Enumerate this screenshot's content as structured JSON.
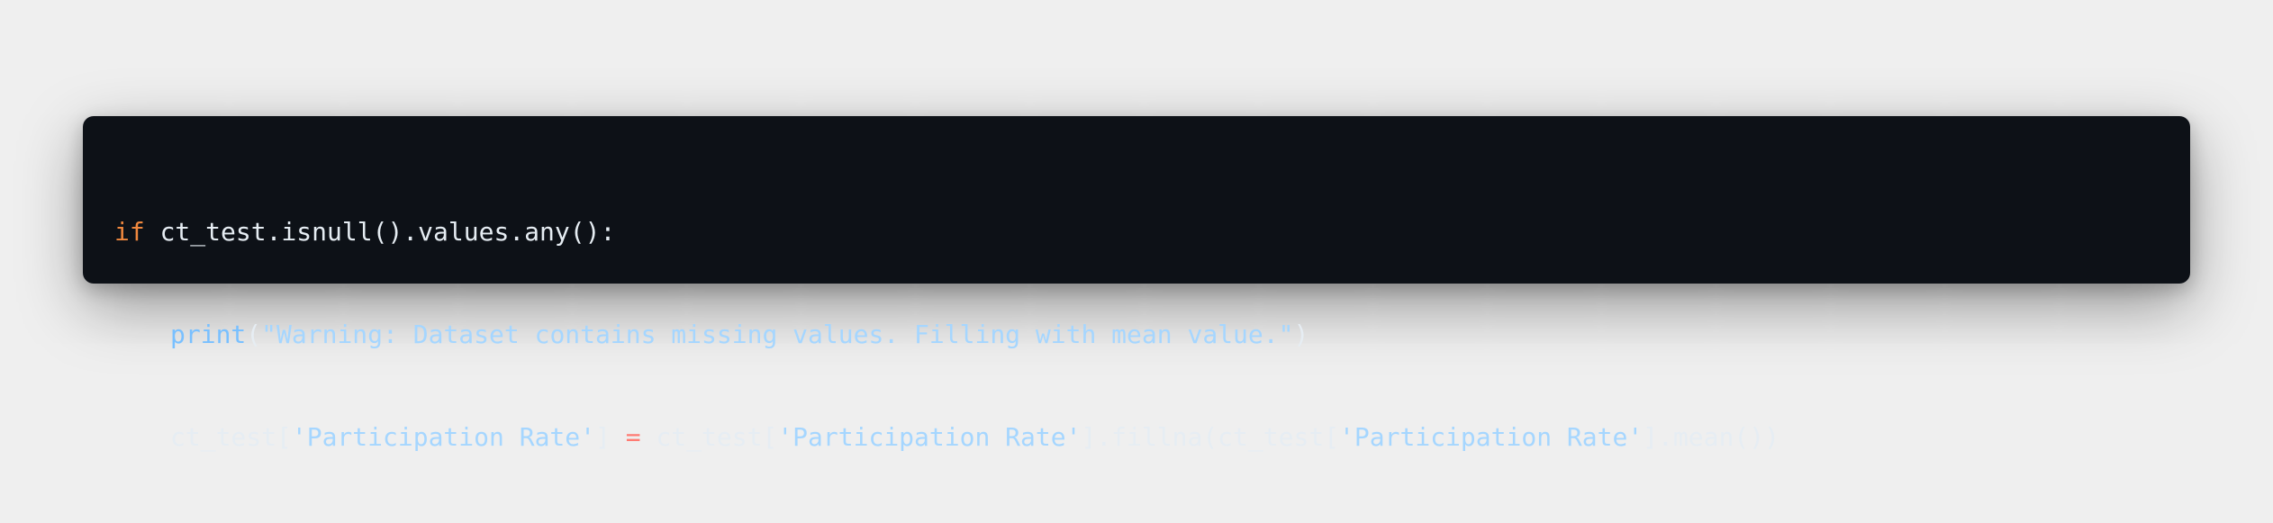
{
  "code": {
    "line1": {
      "keyword": "if",
      "rest": " ct_test.isnull().values.any():"
    },
    "line2": {
      "func": "print",
      "open": "(",
      "string": "\"Warning: Dataset contains missing values. Filling with mean value.\"",
      "close": ")"
    },
    "line3": {
      "part1": "ct_test[",
      "str1": "'Participation Rate'",
      "part2": "] ",
      "op": "=",
      "part3": " ct_test[",
      "str2": "'Participation Rate'",
      "part4": "].fillna(ct_test[",
      "str3": "'Participation Rate'",
      "part5": "].mean())"
    }
  },
  "colors": {
    "background": "#efefef",
    "card": "#0d1117",
    "keyword": "#f0883e",
    "string": "#a5d6ff",
    "function": "#79c0ff",
    "operator": "#ff7b72",
    "text": "#e6edf3"
  }
}
